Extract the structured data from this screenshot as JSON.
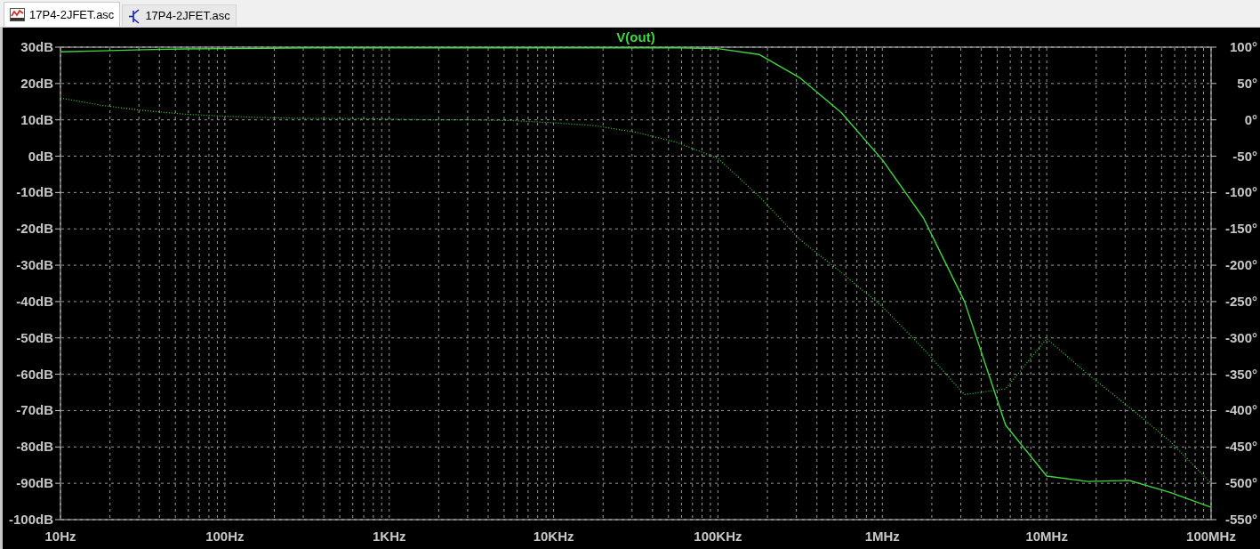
{
  "tabs": [
    {
      "label": "17P4-2JFET.asc",
      "selected": true,
      "kind": "plot"
    },
    {
      "label": "17P4-2JFET.asc",
      "selected": false,
      "kind": "schematic"
    }
  ],
  "plot": {
    "chart_data": {
      "type": "line",
      "title": "V(out)",
      "categories": [
        "10Hz",
        null,
        null,
        null,
        "100Hz",
        null,
        null,
        null,
        "1KHz",
        null,
        null,
        null,
        "10KHz",
        null,
        null,
        null,
        "100KHz",
        null,
        null,
        null,
        "1MHz",
        null,
        null,
        null,
        "10MHz",
        null,
        null,
        null,
        "100MHz"
      ],
      "series": [
        {
          "color": "#3fd83f",
          "values": [
            28.7,
            29,
            29.3,
            29.5,
            29.6,
            29.7,
            29.8,
            29.8,
            29.8,
            29.8,
            29.8,
            29.8,
            29.8,
            29.8,
            29.8,
            29.8,
            29.6,
            28,
            21.5,
            12,
            -1,
            -17,
            -40,
            -74,
            -88,
            -89.5,
            -89.2,
            -92.5,
            -96.6
          ]
        },
        {
          "color": "#3fd83f",
          "axis": "y2",
          "line_style": "dotted",
          "values": [
            30,
            20,
            13,
            8,
            5,
            3,
            2,
            2,
            1,
            0,
            0,
            -1,
            -4,
            -8,
            -17,
            -31,
            -53,
            -105,
            -165,
            -210,
            -257,
            -315,
            -378,
            -370,
            -301,
            -350,
            -395,
            -442,
            -500
          ]
        }
      ],
      "grid": true,
      "ylim": [
        -100,
        30
      ],
      "y2lim": [
        -550,
        100
      ],
      "yticks": [
        {
          "value": 30,
          "label": "30dB"
        },
        {
          "value": 20,
          "label": "20dB"
        },
        {
          "value": 10,
          "label": "10dB"
        },
        {
          "value": 0,
          "label": "0dB"
        },
        {
          "value": -10,
          "label": "-10dB"
        },
        {
          "value": -20,
          "label": "-20dB"
        },
        {
          "value": -30,
          "label": "-30dB"
        },
        {
          "value": -40,
          "label": "-40dB"
        },
        {
          "value": -50,
          "label": "-50dB"
        },
        {
          "value": -60,
          "label": "-60dB"
        },
        {
          "value": -70,
          "label": "-70dB"
        },
        {
          "value": -80,
          "label": "-80dB"
        },
        {
          "value": -90,
          "label": "-90dB"
        },
        {
          "value": -100,
          "label": "-100dB"
        }
      ],
      "y2ticks": [
        {
          "value": 100,
          "label": "100°"
        },
        {
          "value": 50,
          "label": "50°"
        },
        {
          "value": 0,
          "label": "0°"
        },
        {
          "value": -50,
          "label": "-50°"
        },
        {
          "value": -100,
          "label": "-100°"
        },
        {
          "value": -150,
          "label": "-150°"
        },
        {
          "value": -200,
          "label": "-200°"
        },
        {
          "value": -250,
          "label": "-250°"
        },
        {
          "value": -300,
          "label": "-300°"
        },
        {
          "value": -350,
          "label": "-350°"
        },
        {
          "value": -400,
          "label": "-400°"
        },
        {
          "value": -450,
          "label": "-450°"
        },
        {
          "value": -500,
          "label": "-500°"
        },
        {
          "value": -550,
          "label": "-550°"
        }
      ]
    }
  }
}
